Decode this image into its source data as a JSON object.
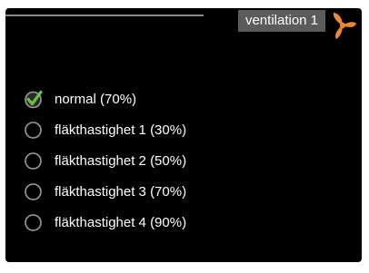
{
  "header": {
    "title": "ventilation 1",
    "icon": "fan-icon",
    "icon_color": "#e8863a",
    "line_color": "#8a8a8a",
    "title_bg": "#5b5b5b"
  },
  "options": [
    {
      "label": "normal (70%)",
      "selected": true
    },
    {
      "label": "fläkthastighet 1 (30%)",
      "selected": false
    },
    {
      "label": "fläkthastighet 2 (50%)",
      "selected": false
    },
    {
      "label": "fläkthastighet 3 (70%)",
      "selected": false
    },
    {
      "label": "fläkthastighet 4 (90%)",
      "selected": false
    }
  ],
  "colors": {
    "background": "#000000",
    "text": "#ffffff",
    "check": "#6cc04a",
    "radio_ring": "#9a9a9a"
  }
}
